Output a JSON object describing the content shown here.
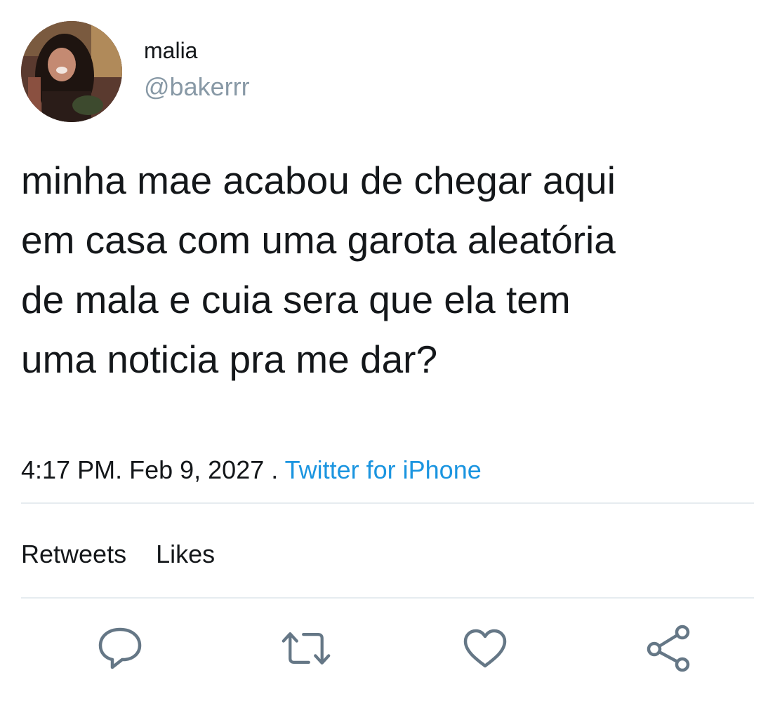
{
  "user": {
    "display_name": "malia",
    "handle": "@bakerrr"
  },
  "tweet": {
    "text": "minha mae acabou de chegar aqui\nem casa com uma garota aleatória\nde mala e cuia sera que ela tem\numa noticia pra me dar?",
    "time": "4:17 PM",
    "date_sep": ". ",
    "date": "Feb 9, 2027",
    "source_sep": " . ",
    "source": "Twitter for iPhone"
  },
  "stats": {
    "retweets_label": "Retweets",
    "likes_label": "Likes"
  },
  "actions": [
    {
      "name": "reply",
      "icon": "reply-icon"
    },
    {
      "name": "retweet",
      "icon": "retweet-icon"
    },
    {
      "name": "like",
      "icon": "heart-icon"
    },
    {
      "name": "share",
      "icon": "share-icon"
    }
  ],
  "colors": {
    "text": "#14171a",
    "secondary": "#8899a6",
    "link": "#1b95e0",
    "icon": "#657786",
    "divider": "#e6ecf0"
  }
}
